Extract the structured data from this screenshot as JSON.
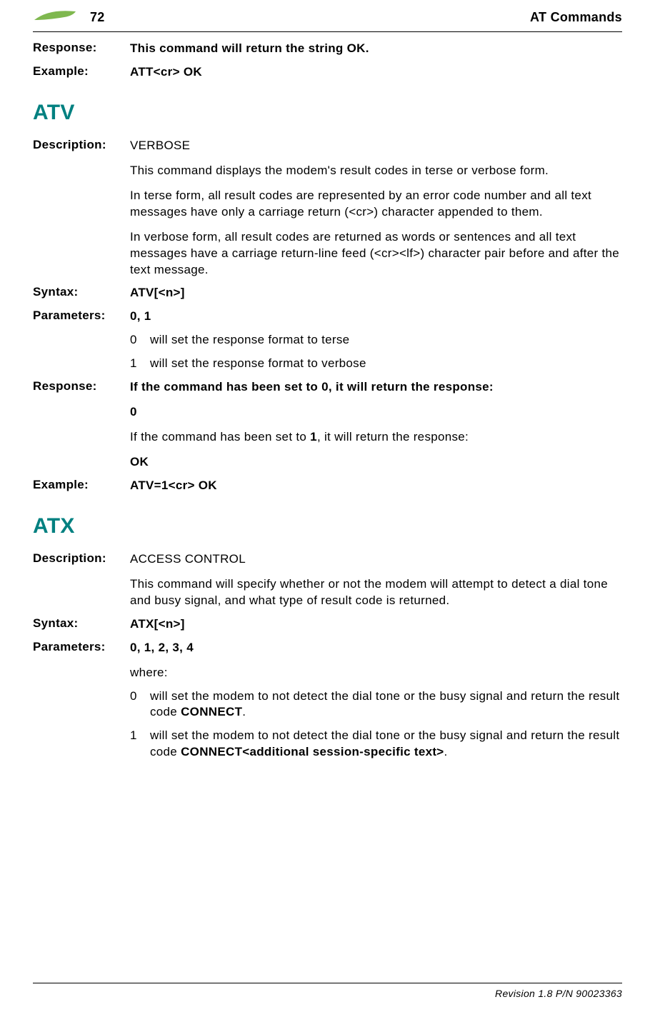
{
  "header": {
    "page_number": "72",
    "title": "AT Commands"
  },
  "top": {
    "response_label": "Response:",
    "response_value": "This command will return the string OK.",
    "example_label": "Example:",
    "example_value": "ATT<cr> OK"
  },
  "atv": {
    "heading": "ATV",
    "description_label": "Description:",
    "description_term": "VERBOSE",
    "description_p1": "This command displays the modem's result codes in terse or verbose form.",
    "description_p2": "In terse form, all result codes are represented by an error code number and all text messages have only a carriage return (<cr>) character appended to them.",
    "description_p3": "In verbose form, all result codes are returned as words or sentences and all text messages have a carriage return-line feed (<cr><lf>) character pair before and after the text message.",
    "syntax_label": "Syntax:",
    "syntax_value": "ATV[<n>]",
    "parameters_label": "Parameters:",
    "parameters_value": "0, 1",
    "param0_n": "0",
    "param0_t": "will set the response format to terse",
    "param1_n": "1",
    "param1_t": "will set the response format to verbose",
    "response_label": "Response:",
    "response_line1": "If the command has been set to 0, it will return the response:",
    "response_zero": "0",
    "response_line2a": "If the command has been set to ",
    "response_line2b": "1",
    "response_line2c": ", it will return the response:",
    "response_ok": "OK",
    "example_label": "Example:",
    "example_value": "ATV=1<cr> OK"
  },
  "atx": {
    "heading": "ATX",
    "description_label": "Description:",
    "description_term": "ACCESS CONTROL",
    "description_p1": "This command will specify whether or not the modem will attempt to detect a dial tone and busy signal, and what type of result code is returned.",
    "syntax_label": "Syntax:",
    "syntax_value": "ATX[<n>]",
    "parameters_label": "Parameters:",
    "parameters_value": "0, 1, 2, 3, 4",
    "where": "where:",
    "param0_n": "0",
    "param0_t_a": "will set the modem to not detect the dial tone or the busy signal and return the result code ",
    "param0_t_b": "CONNECT",
    "param0_t_c": ".",
    "param1_n": "1",
    "param1_t_a": "will set the modem to not detect the dial tone or the busy signal and return the result code ",
    "param1_t_b": "CONNECT<additional session-specific text>",
    "param1_t_c": "."
  },
  "footer": {
    "text": "Revision 1.8  P/N 90023363"
  }
}
